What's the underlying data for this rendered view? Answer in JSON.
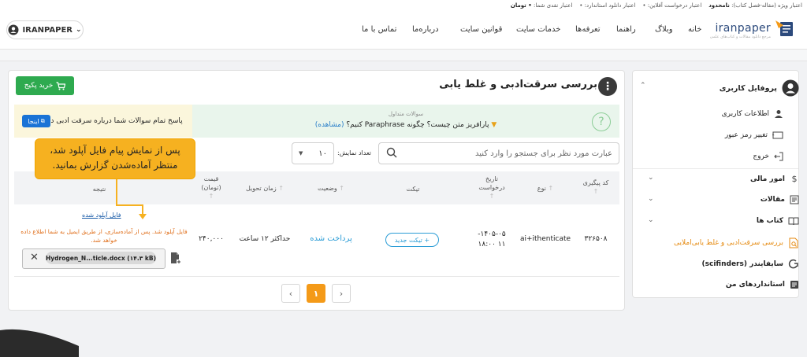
{
  "nav": {
    "logo": "iranpaper",
    "logo_sub": "مرجع دانلود مقالات و کتاب‌های علمی",
    "links": [
      "خانه",
      "وبلاگ",
      "راهنما",
      "تعرفه‌ها",
      "خدمات سایت",
      "قوانین سایت",
      "درباره‌ما",
      "تماس با ما"
    ],
    "user": "IRANPAPER"
  },
  "strip": {
    "special_label": "اعتبار ویژه (مقاله-فصل کتاب):",
    "special_value": "نامحدود",
    "online_label": "اعتبار درخواست آفلاین:",
    "online_value": "•",
    "download_label": "اعتبار دانلود استاندارد:",
    "download_value": "•",
    "cash_label": "اعتبار نقدی شما:",
    "cash_value": "• تومان"
  },
  "sidebar": {
    "profile": "پروفایل کاربری",
    "items": [
      "اطلاعات کاربری",
      "تغییر رمز عبور",
      "خروج"
    ],
    "sections": [
      "امور مالی",
      "مقالات",
      "کتاب ها"
    ],
    "active": "بررسی سرقت‌ادبی و غلط یابی‌املایی",
    "scifinder": "سایفایندر (scifinders)",
    "standards": "استانداردهای من"
  },
  "main": {
    "title": "بررسی سرقت‌ادبی و غلط یابی",
    "buy_label": "خرید پکیج",
    "faq_title": "سوالات متداول",
    "faq_question": "پارافریز متن چیست؟ چگونه Paraphrase کنیم؟",
    "faq_view": "(مشاهده)",
    "answers_text": "پاسخ تمام سوالات شما درباره سرقت ادبی در",
    "here_label": "اینجا",
    "search_placeholder": "عبارت مورد نظر برای جستجو را وارد کنید",
    "count_label": "تعداد نمایش:",
    "count_value": "۱۰"
  },
  "callout": {
    "line1": "پس از نمایش پیام فایل آپلود شد،",
    "line2": "منتظر آماده‌شدن گزارش بمانید."
  },
  "table": {
    "headers": {
      "code": "کد پیگیری",
      "type": "نوع",
      "date_l1": "تاریخ",
      "date_l2": "درخواست",
      "ticket": "تیکت",
      "status": "وضعیت",
      "delivery": "زمان تحویل",
      "price_l1": "قیمت",
      "price_l2": "(تومان)",
      "result": "نتیجه"
    },
    "row": {
      "code": "۳۲۶۵۰۸",
      "type": "ai+ithenticate",
      "date_l1": "۱۴۰۵-۰۵-",
      "date_l2": "۱۱ ۱۸:۰۰",
      "ticket_label": "+ تیکت جدید",
      "status": "پرداخت شده",
      "delivery": "حداکثر ۱۲ ساعت",
      "price": "۲۴۰,۰۰۰",
      "file_link": "فایل آپلود شده",
      "message": "فایل آپلود شد. پس از آماده‌سازی، از طریق ایمیل به شما اطلاع داده خواهد شد.",
      "file_name": "Hydrogen_N...ticle.docx (۱۴.۳ kB)"
    }
  },
  "pagination": {
    "current": "۱",
    "prev": "‹",
    "next": "›"
  }
}
